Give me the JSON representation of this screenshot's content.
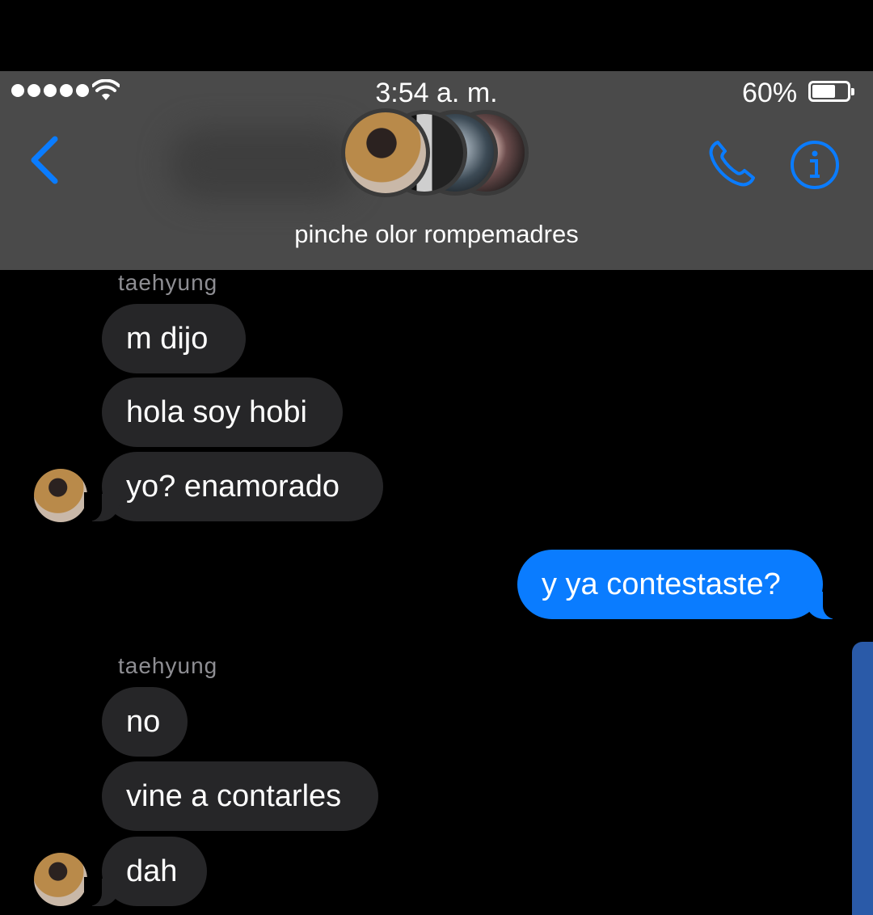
{
  "status_bar": {
    "time": "3:54 a. m.",
    "battery_percent": "60%",
    "battery_level": 0.6
  },
  "header": {
    "group_name": "pinche olor rompemadres",
    "back_icon": "chevron-left-icon",
    "call_icon": "phone-icon",
    "info_icon": "info-icon",
    "accent_color": "#0a7cff"
  },
  "messages": [
    {
      "sender": "taehyung"
    },
    {
      "text": "m dijo"
    },
    {
      "text": "hola soy hobi"
    },
    {
      "text": "yo? enamorado"
    },
    {
      "text": "y ya contestaste?",
      "outgoing": true
    },
    {
      "sender": "taehyung"
    },
    {
      "text": "no"
    },
    {
      "text": "vine a contarles"
    },
    {
      "text": "dah"
    }
  ]
}
